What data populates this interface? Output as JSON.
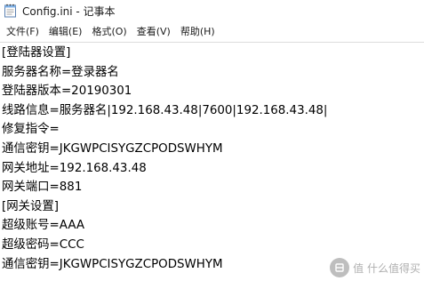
{
  "window": {
    "title": "Config.ini - 记事本",
    "app_icon": "notepad-icon"
  },
  "menu": [
    {
      "label": "文件(F)"
    },
    {
      "label": "编辑(E)"
    },
    {
      "label": "格式(O)"
    },
    {
      "label": "查看(V)"
    },
    {
      "label": "帮助(H)"
    }
  ],
  "document": {
    "lines": [
      "[登陆器设置]",
      "服务器名称=登录器名",
      "登陆器版本=20190301",
      "线路信息=服务器名|192.168.43.48|7600|192.168.43.48|",
      "修复指令=",
      "通信密钥=JKGWPCISYGZCPODSWHYM",
      "网关地址=192.168.43.48",
      "网关端口=881",
      "[网关设置]",
      "超级账号=AAA",
      "超级密码=CCC",
      "通信密钥=JKGWPCISYGZCPODSWHYM"
    ]
  },
  "watermark": {
    "text": "值 什么值得买",
    "icon": "smzdm-logo-icon"
  }
}
